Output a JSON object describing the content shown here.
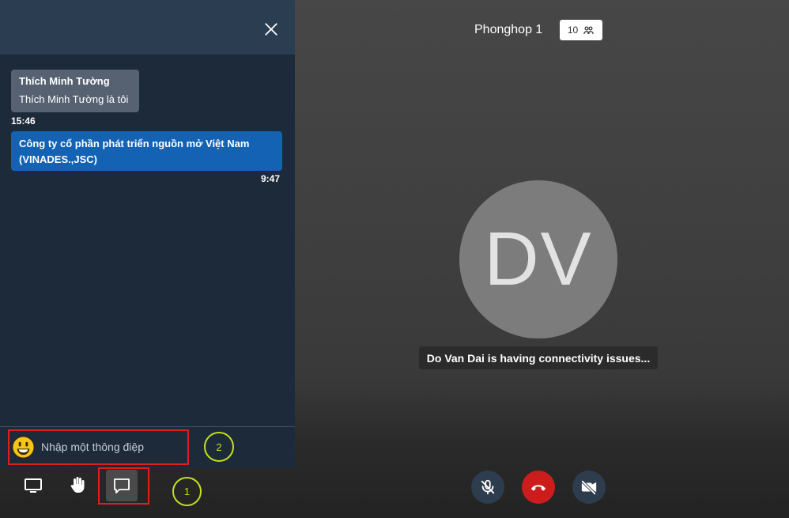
{
  "room": {
    "name": "Phonghop 1",
    "participant_count": "10"
  },
  "avatar": {
    "initials": "DV"
  },
  "connectivity_message": "Do Van Dai is having connectivity issues...",
  "chat": {
    "messages": [
      {
        "direction": "incoming",
        "sender": "Thích Minh Tường",
        "text": "Thích Minh Tường là tôi",
        "time": "15:46"
      },
      {
        "direction": "outgoing",
        "text": "Công ty cổ phần phát triển nguồn mở Việt Nam (VINADES.,JSC)",
        "time": "9:47"
      }
    ],
    "input_placeholder": "Nhập một thông điệp"
  },
  "annotations": {
    "marker_1": "1",
    "marker_2": "2"
  },
  "colors": {
    "chat_bg": "#1c2a3a",
    "outgoing_bubble": "#1462b4",
    "hangup": "#cc1c1c",
    "highlight": "#e02020",
    "marker": "#c6e01b"
  },
  "icons": [
    "close-icon",
    "participants-icon",
    "emoji-icon",
    "screen-share-icon",
    "raise-hand-icon",
    "chat-icon",
    "mic-muted-icon",
    "hangup-icon",
    "camera-off-icon"
  ]
}
